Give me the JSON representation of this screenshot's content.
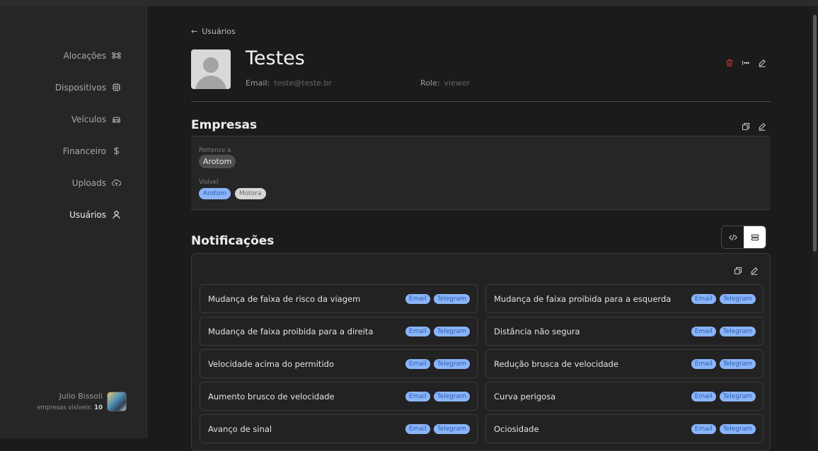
{
  "sidebar": {
    "items": [
      {
        "label": "Alocações",
        "icon": "command-icon"
      },
      {
        "label": "Dispositivos",
        "icon": "chip-icon"
      },
      {
        "label": "Veículos",
        "icon": "car-icon"
      },
      {
        "label": "Financeiro",
        "icon": "dollar-icon"
      },
      {
        "label": "Uploads",
        "icon": "cloud-upload-icon"
      },
      {
        "label": "Usuários",
        "icon": "user-icon",
        "active": true
      }
    ],
    "user": {
      "name": "Julio Bissoli",
      "visible_label": "empresas visíveis:",
      "visible_count": "10"
    }
  },
  "header": {
    "back_label": "Usuários",
    "title": "Testes",
    "email_label": "Email:",
    "email_value": "teste@teste.br",
    "role_label": "Role:",
    "role_value": "viewer"
  },
  "empresas": {
    "title": "Empresas",
    "belongs_label": "Pertence a",
    "belongs_value": "Arotom",
    "visible_label": "Visível",
    "visible_values": [
      "Arotom",
      "Motora"
    ]
  },
  "notificacoes": {
    "title": "Notificações",
    "items": [
      {
        "label": "Mudança de faixa de risco da viagem",
        "channels": [
          "Email",
          "Telegram"
        ]
      },
      {
        "label": "Mudança de faixa proibida para a esquerda",
        "channels": [
          "Email",
          "Telegram"
        ]
      },
      {
        "label": "Mudança de faixa proibida para a direita",
        "channels": [
          "Email",
          "Telegram"
        ]
      },
      {
        "label": "Distância não segura",
        "channels": [
          "Email",
          "Telegram"
        ]
      },
      {
        "label": "Velocidade acima do permitido",
        "channels": [
          "Email",
          "Telegram"
        ]
      },
      {
        "label": "Redução brusca de velocidade",
        "channels": [
          "Email",
          "Telegram"
        ]
      },
      {
        "label": "Aumento brusco de velocidade",
        "channels": [
          "Email",
          "Telegram"
        ]
      },
      {
        "label": "Curva perigosa",
        "channels": [
          "Email",
          "Telegram"
        ]
      },
      {
        "label": "Avanço de sinal",
        "channels": [
          "Email",
          "Telegram"
        ]
      },
      {
        "label": "Ociosidade",
        "channels": [
          "Email",
          "Telegram"
        ]
      }
    ]
  },
  "colors": {
    "accent_blue": "#8ab4f8",
    "danger": "#c0392b"
  }
}
